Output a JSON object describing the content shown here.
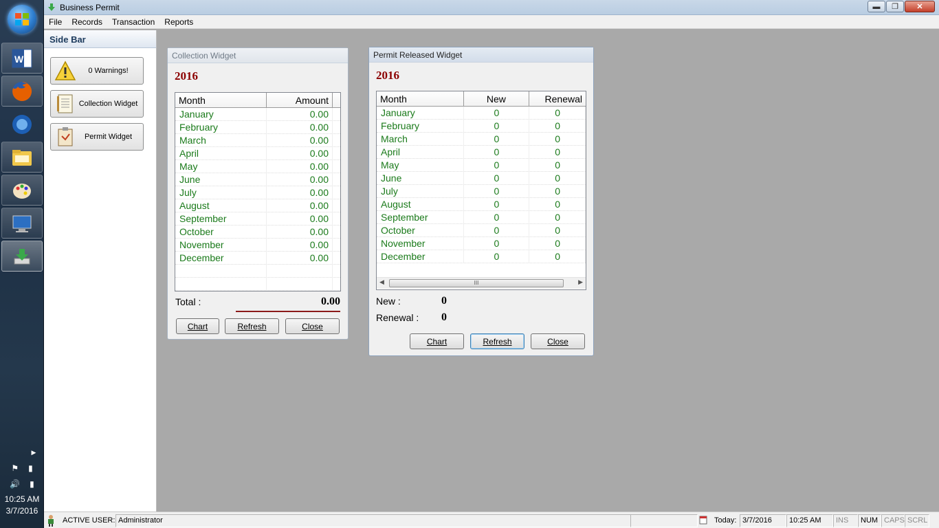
{
  "window": {
    "title": "Business Permit"
  },
  "menu": [
    "File",
    "Records",
    "Transaction",
    "Reports"
  ],
  "sidebar": {
    "title": "Side Bar",
    "buttons": [
      {
        "label": "0 Warnings!",
        "icon": "warning-icon"
      },
      {
        "label": "Collection Widget",
        "icon": "ledger-icon"
      },
      {
        "label": "Permit Widget",
        "icon": "clipboard-icon"
      }
    ]
  },
  "collection_widget": {
    "title": "Collection Widget",
    "year": "2016",
    "columns": [
      "Month",
      "Amount"
    ],
    "rows": [
      [
        "January",
        "0.00"
      ],
      [
        "February",
        "0.00"
      ],
      [
        "March",
        "0.00"
      ],
      [
        "April",
        "0.00"
      ],
      [
        "May",
        "0.00"
      ],
      [
        "June",
        "0.00"
      ],
      [
        "July",
        "0.00"
      ],
      [
        "August",
        "0.00"
      ],
      [
        "September",
        "0.00"
      ],
      [
        "October",
        "0.00"
      ],
      [
        "November",
        "0.00"
      ],
      [
        "December",
        "0.00"
      ]
    ],
    "total_label": "Total :",
    "total_value": "0.00",
    "buttons": {
      "chart": "Chart",
      "refresh": "Refresh",
      "close": "Close"
    }
  },
  "permit_widget": {
    "title": "Permit Released Widget",
    "year": "2016",
    "columns": [
      "Month",
      "New",
      "Renewal"
    ],
    "rows": [
      [
        "January",
        "0",
        "0"
      ],
      [
        "February",
        "0",
        "0"
      ],
      [
        "March",
        "0",
        "0"
      ],
      [
        "April",
        "0",
        "0"
      ],
      [
        "May",
        "0",
        "0"
      ],
      [
        "June",
        "0",
        "0"
      ],
      [
        "July",
        "0",
        "0"
      ],
      [
        "August",
        "0",
        "0"
      ],
      [
        "September",
        "0",
        "0"
      ],
      [
        "October",
        "0",
        "0"
      ],
      [
        "November",
        "0",
        "0"
      ],
      [
        "December",
        "0",
        "0"
      ]
    ],
    "new_label": "New :",
    "new_value": "0",
    "renewal_label": "Renewal :",
    "renewal_value": "0",
    "scroll_grip": "III",
    "buttons": {
      "chart": "Chart",
      "refresh": "Refresh",
      "close": "Close"
    }
  },
  "statusbar": {
    "active_user_label": "ACTIVE USER:",
    "active_user": "Administrator",
    "today_label": "Today:",
    "date": "3/7/2016",
    "time": "10:25 AM",
    "indicators": [
      "INS",
      "NUM",
      "CAPS",
      "SCRL"
    ]
  },
  "taskbar": {
    "time": "10:25 AM",
    "date": "3/7/2016"
  },
  "colors": {
    "year": "#8b0000",
    "grid_text": "#1a7a1a",
    "workspace": "#a9a9a9"
  }
}
